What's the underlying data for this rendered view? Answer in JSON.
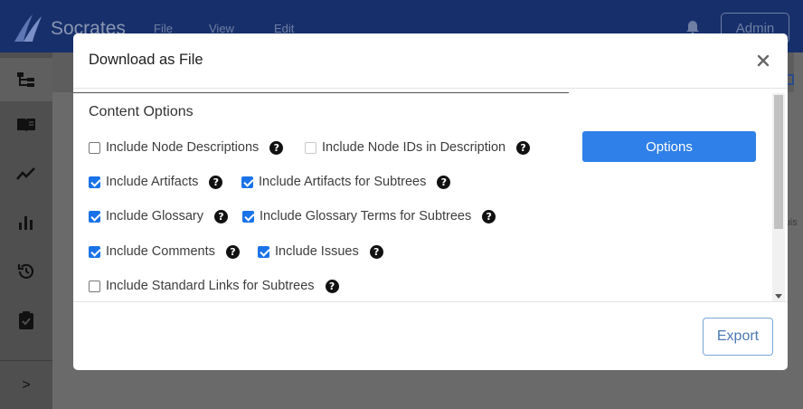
{
  "app": {
    "name": "Socrates",
    "menu": [
      "File",
      "View",
      "Edit"
    ],
    "admin_label": "Admin",
    "main_fragment": "ruis"
  },
  "sidebar": {
    "items": [
      {
        "icon": "tree-icon"
      },
      {
        "icon": "book-icon"
      },
      {
        "icon": "trend-icon"
      },
      {
        "icon": "bar-chart-icon"
      },
      {
        "icon": "history-icon"
      },
      {
        "icon": "clipboard-check-icon"
      }
    ],
    "expand_label": ">"
  },
  "modal": {
    "title": "Download as File",
    "close_label": "×",
    "section_title": "Content Options",
    "options_button": "Options",
    "export_button": "Export",
    "help_glyph": "?",
    "options": [
      {
        "label": "Include Node Descriptions",
        "checked": false,
        "disabled": false
      },
      {
        "label": "Include Node IDs in Description",
        "checked": false,
        "disabled": true
      },
      {
        "label": "Include Artifacts",
        "checked": true,
        "disabled": false
      },
      {
        "label": "Include Artifacts for Subtrees",
        "checked": true,
        "disabled": false
      },
      {
        "label": "Include Glossary",
        "checked": true,
        "disabled": false
      },
      {
        "label": "Include Glossary Terms for Subtrees",
        "checked": true,
        "disabled": false
      },
      {
        "label": "Include Comments",
        "checked": true,
        "disabled": false
      },
      {
        "label": "Include Issues",
        "checked": true,
        "disabled": false
      },
      {
        "label": "Include Standard Links for Subtrees",
        "checked": false,
        "disabled": false
      }
    ]
  },
  "colors": {
    "topbar": "#17306b",
    "primary": "#2f80e8",
    "checkbox_checked": "#1a73e8"
  }
}
